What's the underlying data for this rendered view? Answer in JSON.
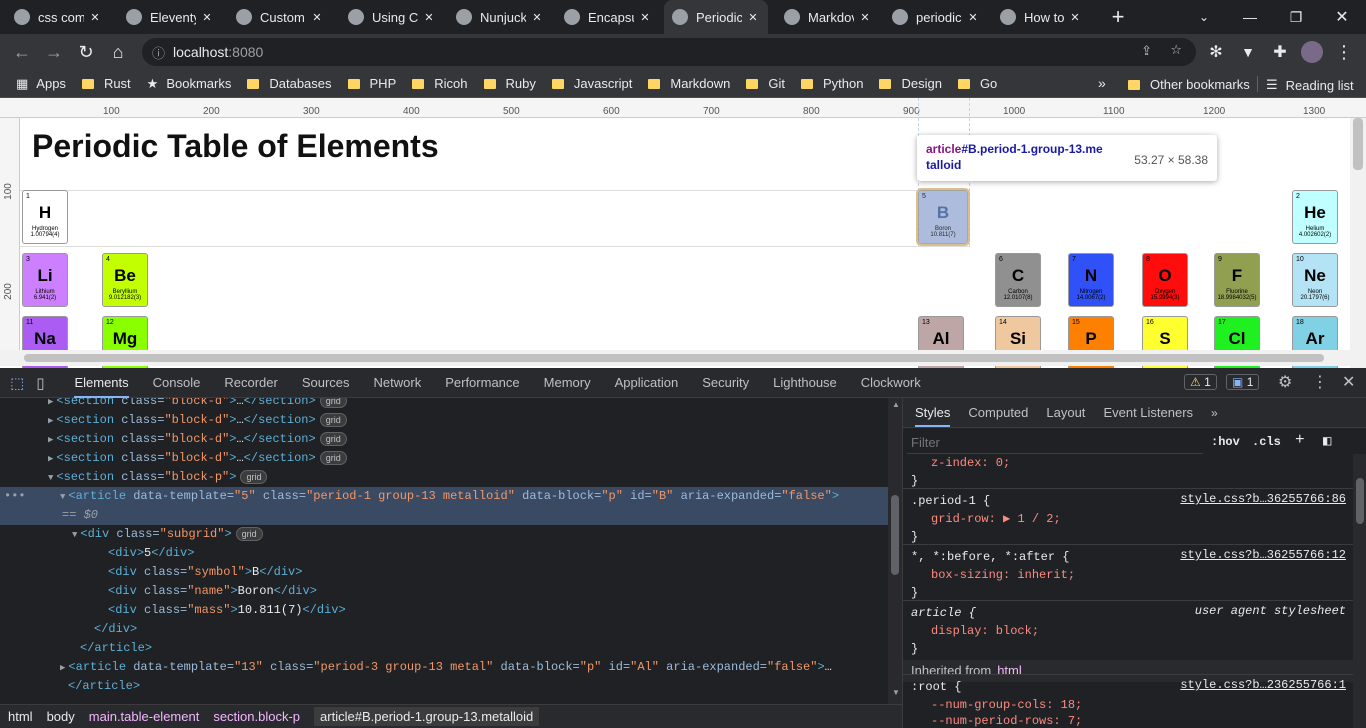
{
  "browser": {
    "tabs": [
      {
        "title": "css com",
        "icon": "google-icon"
      },
      {
        "title": "Eleventy",
        "icon": "eleventy-icon"
      },
      {
        "title": "Custom",
        "icon": "github-icon"
      },
      {
        "title": "Using CS",
        "icon": "github-icon"
      },
      {
        "title": "Nunjuck",
        "icon": "nunjucks-icon"
      },
      {
        "title": "Encapsu",
        "icon": "tutorial-icon"
      },
      {
        "title": "Periodic",
        "icon": "globe-icon",
        "active": true
      },
      {
        "title": "Markdov",
        "icon": "globe-icon"
      },
      {
        "title": "periodic",
        "icon": "google-icon"
      },
      {
        "title": "How to",
        "icon": "page-icon"
      }
    ],
    "address": {
      "host": "localhost",
      "port": ":8080"
    },
    "bookmarks": [
      "Apps",
      "Rust",
      "Bookmarks",
      "Databases",
      "PHP",
      "Ricoh",
      "Ruby",
      "Javascript",
      "Markdown",
      "Git",
      "Python",
      "Design",
      "Go"
    ],
    "other_bookmarks": "Other bookmarks",
    "reading_list": "Reading list",
    "more_bookmarks": "»"
  },
  "page": {
    "title": "Periodic Table of Elements",
    "ruler_ticks": [
      "100",
      "200",
      "300",
      "400",
      "500",
      "600",
      "700",
      "800",
      "900",
      "1000",
      "1100",
      "1200",
      "1300"
    ],
    "vruler_ticks": [
      "100",
      "200"
    ],
    "tooltip": {
      "selector_tag": "article",
      "selector_rest": "#B.period-1.group-13.me",
      "selector_rest2": "talloid",
      "dims": "53.27 × 58.38"
    },
    "elements": [
      {
        "num": "1",
        "sym": "H",
        "name": "Hydrogen",
        "mass": "1.00794(4)",
        "color": "#ffffff"
      },
      {
        "num": "5",
        "sym": "B",
        "name": "Boron",
        "mass": "10.811(7)",
        "color": "#b8c7a0"
      },
      {
        "num": "2",
        "sym": "He",
        "name": "Helium",
        "mass": "4.002602(2)",
        "color": "#c0ffff"
      },
      {
        "num": "3",
        "sym": "Li",
        "name": "Lithium",
        "mass": "6.941(2)",
        "color": "#cc80ff"
      },
      {
        "num": "4",
        "sym": "Be",
        "name": "Beryllium",
        "mass": "9.012182(3)",
        "color": "#c2ff00"
      },
      {
        "num": "6",
        "sym": "C",
        "name": "Carbon",
        "mass": "12.0107(8)",
        "color": "#909090"
      },
      {
        "num": "7",
        "sym": "N",
        "name": "Nitrogen",
        "mass": "14.0067(2)",
        "color": "#3050f8"
      },
      {
        "num": "8",
        "sym": "O",
        "name": "Oxygen",
        "mass": "15.9994(3)",
        "color": "#ff0d0d"
      },
      {
        "num": "9",
        "sym": "F",
        "name": "Fluorine",
        "mass": "18.9984032(5)",
        "color": "#90a050"
      },
      {
        "num": "10",
        "sym": "Ne",
        "name": "Neon",
        "mass": "20.1797(6)",
        "color": "#b3e3f5"
      },
      {
        "num": "11",
        "sym": "Na",
        "name": "",
        "mass": "",
        "color": "#ab5cf2"
      },
      {
        "num": "12",
        "sym": "Mg",
        "name": "",
        "mass": "",
        "color": "#8aff00"
      },
      {
        "num": "13",
        "sym": "Al",
        "name": "",
        "mass": "",
        "color": "#bfa6a6"
      },
      {
        "num": "14",
        "sym": "Si",
        "name": "",
        "mass": "",
        "color": "#f0c8a0"
      },
      {
        "num": "15",
        "sym": "P",
        "name": "",
        "mass": "",
        "color": "#ff8000"
      },
      {
        "num": "16",
        "sym": "S",
        "name": "",
        "mass": "",
        "color": "#ffff30"
      },
      {
        "num": "17",
        "sym": "Cl",
        "name": "",
        "mass": "",
        "color": "#1ff01f"
      },
      {
        "num": "18",
        "sym": "Ar",
        "name": "",
        "mass": "",
        "color": "#80d1e3"
      }
    ]
  },
  "devtools": {
    "tabs": [
      "Elements",
      "Console",
      "Recorder",
      "Sources",
      "Network",
      "Performance",
      "Memory",
      "Application",
      "Security",
      "Lighthouse",
      "Clockwork"
    ],
    "warnings": "1",
    "messages": "1",
    "dom_lines": [
      "<section class=\"block-d\">…</section>",
      "<section class=\"block-d\">…</section>",
      "<section class=\"block-d\">…</section>",
      "<section class=\"block-d\">…</section>",
      "<section class=\"block-p\">",
      "<article data-template=\"5\" class=\"period-1 group-13 metalloid\" data-block=\"p\" id=\"B\" aria-expanded=\"false\">",
      "== $0",
      "<div class=\"subgrid\">",
      "<div>5</div>",
      "<div class=\"symbol\">B</div>",
      "<div class=\"name\">Boron</div>",
      "<div class=\"mass\">10.811(7)</div>",
      "</div>",
      "</article>",
      "<article data-template=\"13\" class=\"period-3 group-13 metal\" data-block=\"p\" id=\"Al\" aria-expanded=\"false\">…",
      "</article>"
    ],
    "badge_grid": "grid",
    "breadcrumbs": [
      "html",
      "body",
      "main.table-element",
      "section.block-p",
      "article#B.period-1.group-13.metalloid"
    ],
    "styles": {
      "tabs": [
        "Styles",
        "Computed",
        "Layout",
        "Event Listeners"
      ],
      "filter_placeholder": "Filter",
      "hov": ":hov",
      "cls": ".cls",
      "rules": [
        {
          "line": "z-index: 0;"
        },
        {
          "selector": ".period-1 {",
          "source": "style.css?b…36255766:86"
        },
        {
          "line": "grid-row: ▶ 1 / 2;"
        },
        {
          "selector": "*, *:before, *:after {",
          "source": "style.css?b…36255766:12"
        },
        {
          "line": "box-sizing: inherit;"
        },
        {
          "selector": "article {",
          "source": "user agent stylesheet"
        },
        {
          "line": "display: block;"
        },
        {
          "inherited": "Inherited from",
          "from": "html"
        },
        {
          "selector": ":root {",
          "source": "style.css?b…236255766:1"
        },
        {
          "line": "--num-group-cols: 18;"
        },
        {
          "line": "--num-period-rows: 7;"
        }
      ]
    }
  }
}
